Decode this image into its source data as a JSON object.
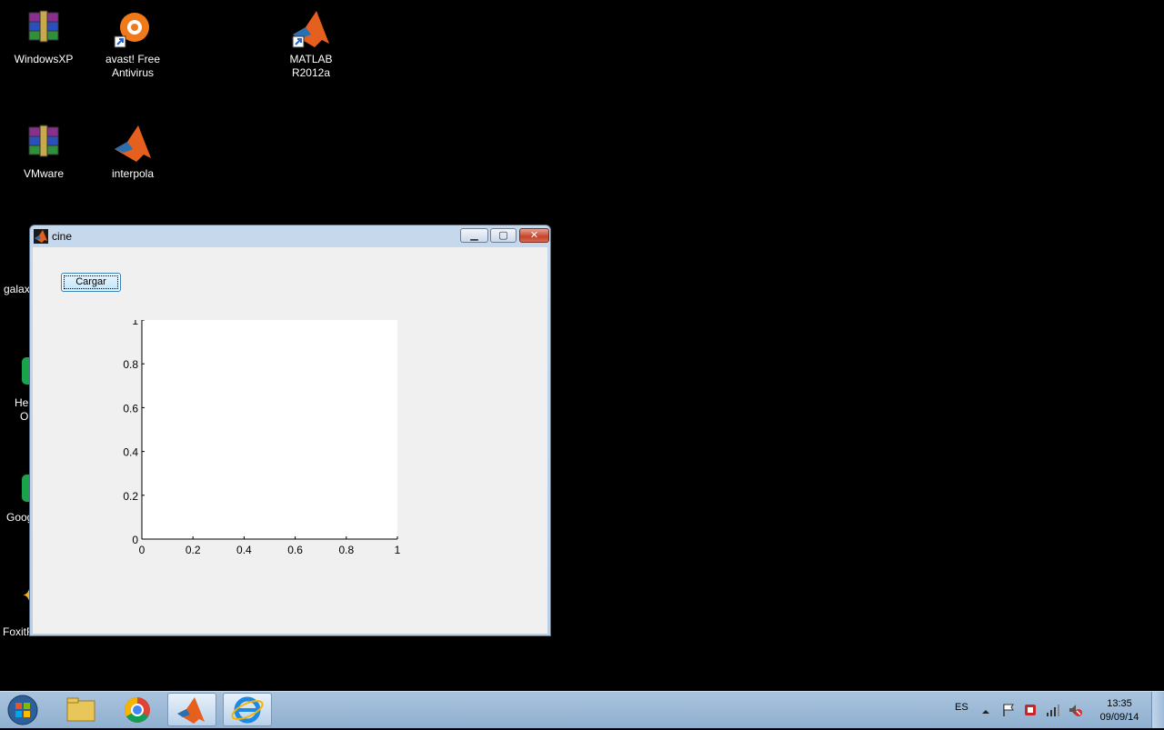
{
  "desktop": {
    "icons": [
      {
        "id": "winrar1",
        "label": "WindowsXP"
      },
      {
        "id": "avast",
        "label": "avast! Free Antivirus"
      },
      {
        "id": "matlab",
        "label": "MATLAB R2012a"
      },
      {
        "id": "winrar2",
        "label": "VMware"
      },
      {
        "id": "interpola",
        "label": "interpola"
      }
    ],
    "clipped": [
      {
        "label": "galax"
      },
      {
        "label": "He"
      },
      {
        "label": "O"
      },
      {
        "label": "Goog"
      },
      {
        "label": "FoxitR"
      }
    ]
  },
  "window": {
    "title": "cine",
    "minimize_glyph": "▁",
    "maximize_glyph": "▢",
    "close_glyph": "✕",
    "button_label": "Cargar"
  },
  "chart_data": {
    "type": "line",
    "x": [],
    "series": [],
    "xlim": [
      0,
      1
    ],
    "ylim": [
      0,
      1
    ],
    "xticks": [
      "0",
      "0.2",
      "0.4",
      "0.6",
      "0.8",
      "1"
    ],
    "yticks": [
      "0",
      "0.2",
      "0.4",
      "0.6",
      "0.8",
      "1"
    ],
    "title": "",
    "xlabel": "",
    "ylabel": "",
    "grid": false
  },
  "taskbar": {
    "language": "ES",
    "time": "13:35",
    "date": "09/09/14",
    "items": [
      "explorer",
      "chrome",
      "matlab",
      "internet-explorer"
    ]
  }
}
